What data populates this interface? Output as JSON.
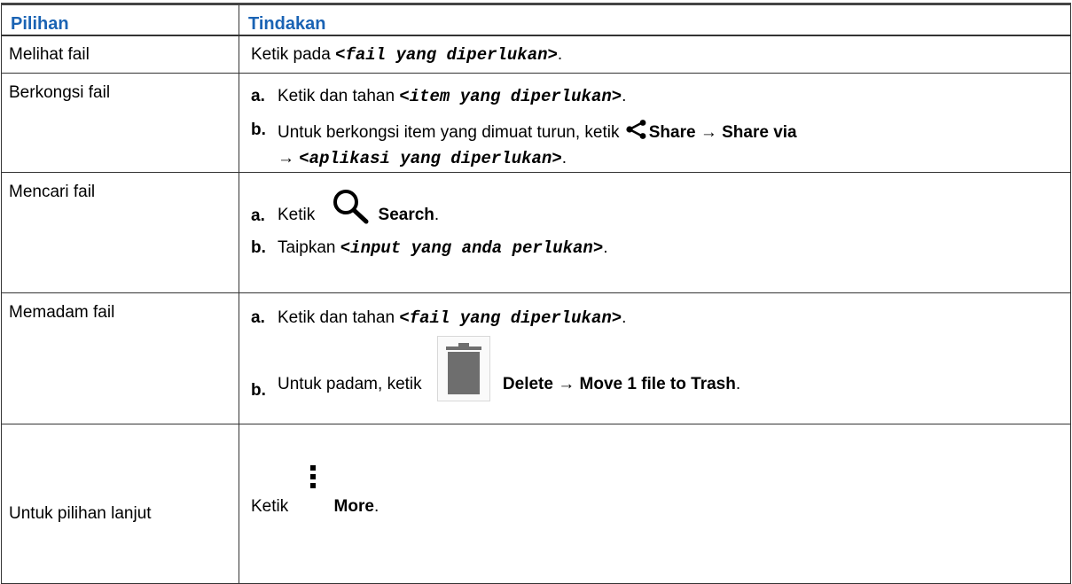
{
  "header": {
    "col_options": "Pilihan",
    "col_actions": "Tindakan"
  },
  "rows": [
    {
      "option": "Melihat fail",
      "text": "Ketik pada",
      "placeholder": "<fail yang diperlukan>",
      "end": "."
    },
    {
      "option": "Berkongsi fail",
      "step_a": {
        "label": "a.",
        "text": "Ketik dan tahan",
        "placeholder": "<item yang diperlukan>",
        "end": "."
      },
      "step_b": {
        "label": "b.",
        "text": "Untuk berkongsi item yang dimuat turun, ketik",
        "icon": "share-icon",
        "bold1": "Share",
        "arrow1": "→",
        "bold2": "Share via",
        "arrow2": "→",
        "placeholder": "<aplikasi yang diperlukan>",
        "end": "."
      }
    },
    {
      "option": "Mencari fail",
      "step_a": {
        "label": "a.",
        "text": "Ketik",
        "icon": "search-icon",
        "bold": "Search",
        "end": "."
      },
      "step_b": {
        "label": "b.",
        "text": "Taipkan",
        "placeholder": "<input yang anda perlukan>",
        "end": "."
      }
    },
    {
      "option": "Memadam fail",
      "step_a": {
        "label": "a.",
        "text": "Ketik dan tahan",
        "placeholder": "<fail yang diperlukan>",
        "end": "."
      },
      "step_b": {
        "label": "b.",
        "text": "Untuk padam, ketik",
        "icon": "trash-icon",
        "bold": "Delete → Move 1 file to Trash",
        "end": "."
      }
    },
    {
      "option": "Untuk pilihan lanjut",
      "text": "Ketik",
      "icon": "more-vert-icon",
      "bold": "More",
      "end": "."
    }
  ],
  "colors": {
    "heading": "#1a63b4",
    "border": "#333333",
    "icon_gray": "#6e6e6e"
  }
}
